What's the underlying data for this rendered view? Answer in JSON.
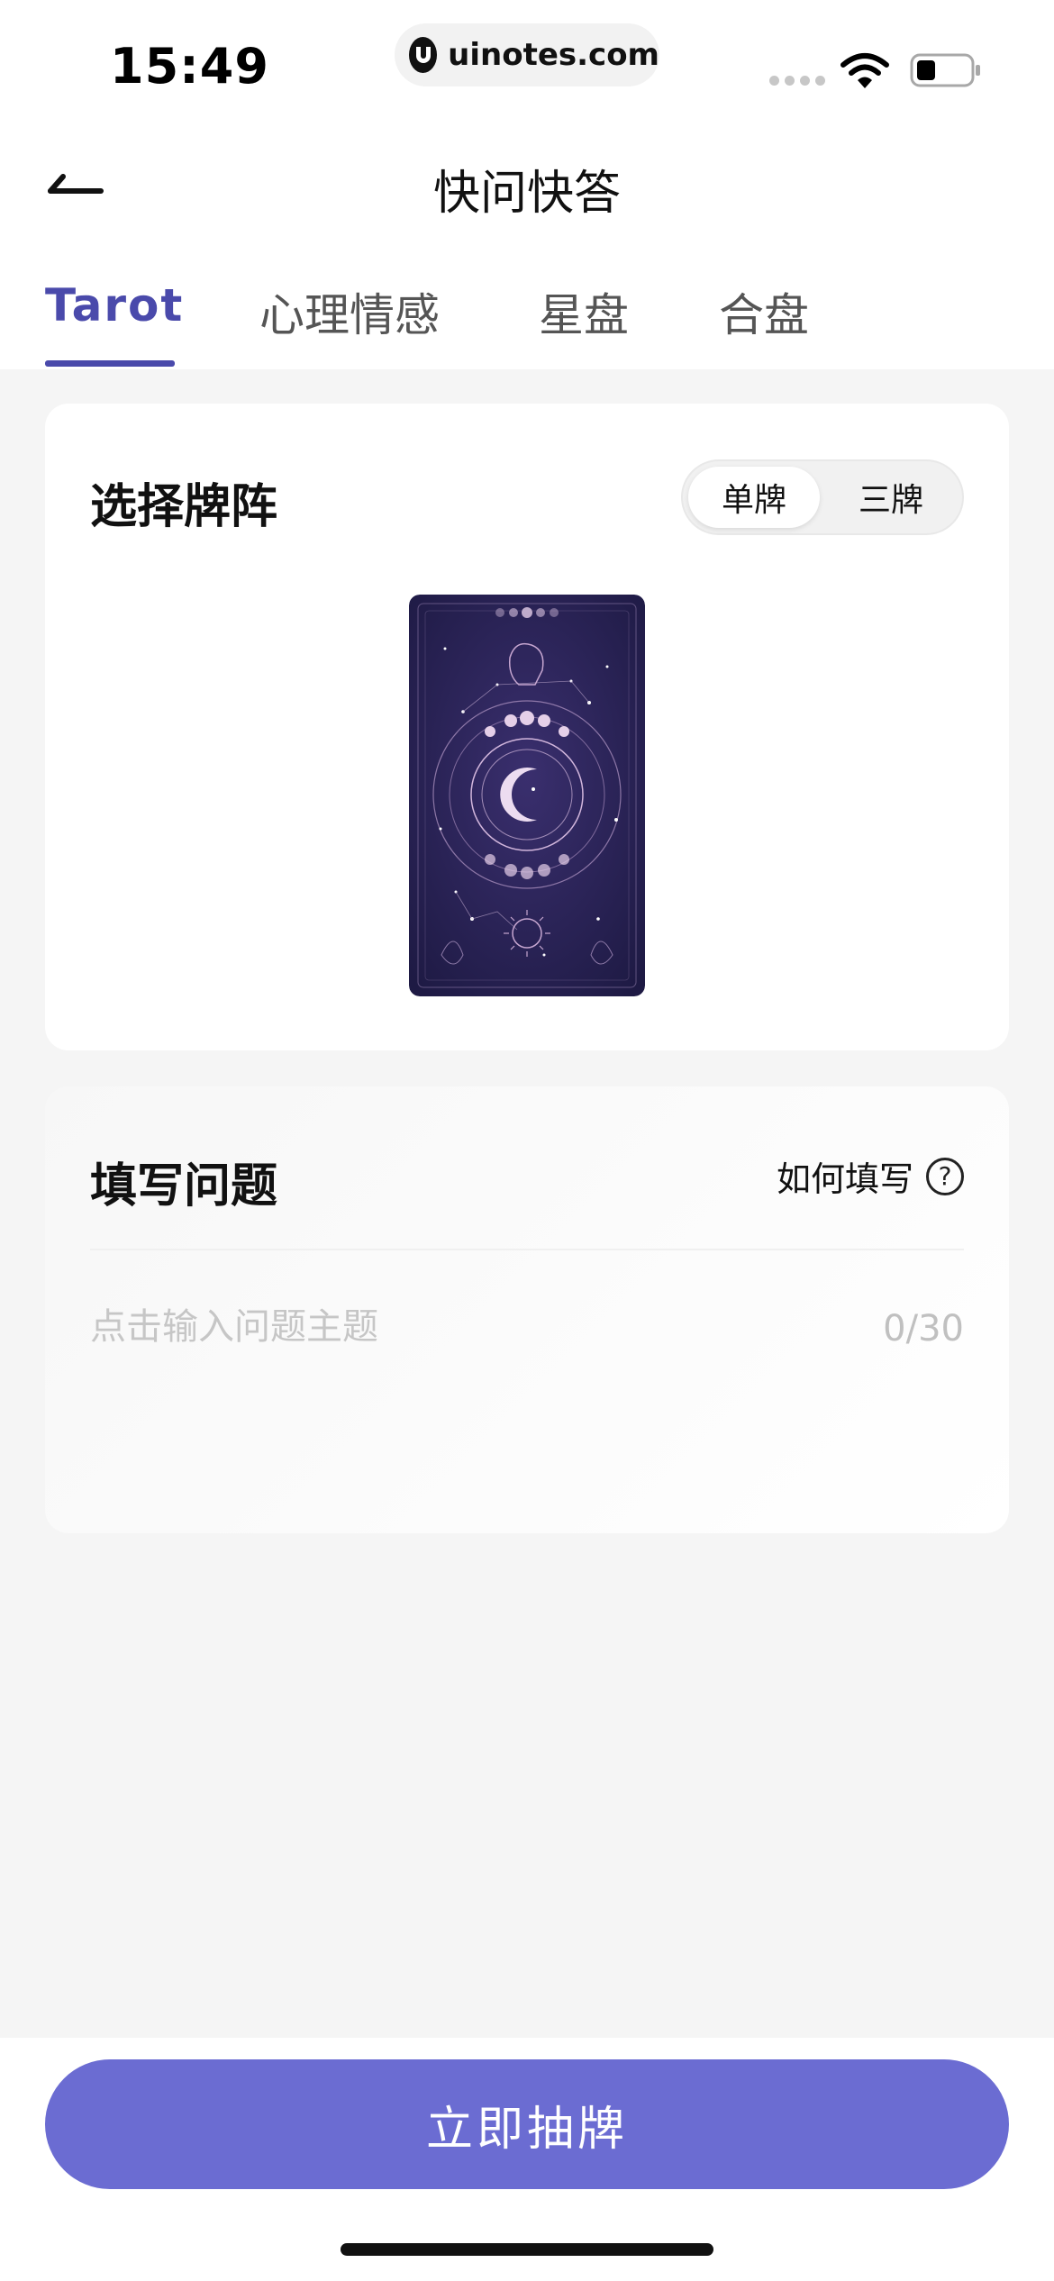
{
  "status_bar": {
    "time": "15:49",
    "url": "uinotes.com"
  },
  "nav": {
    "title": "快问快答",
    "back_icon": "back-arrow-icon"
  },
  "tabs": [
    {
      "label": "Tarot",
      "active": true
    },
    {
      "label": "心理情感",
      "active": false
    },
    {
      "label": "星盘",
      "active": false
    },
    {
      "label": "合盘",
      "active": false
    }
  ],
  "spread": {
    "title": "选择牌阵",
    "options": [
      {
        "label": "单牌",
        "selected": true
      },
      {
        "label": "三牌",
        "selected": false
      }
    ]
  },
  "question": {
    "title": "填写问题",
    "how_to_label": "如何填写",
    "help_icon": "?",
    "placeholder": "点击输入问题主题",
    "value": "",
    "count": "0/30"
  },
  "action": {
    "draw_label": "立即抽牌"
  },
  "colors": {
    "accent": "#4a4aab",
    "button": "#6b6cd2",
    "card_back": "#26214f",
    "background": "#f5f5f5"
  }
}
